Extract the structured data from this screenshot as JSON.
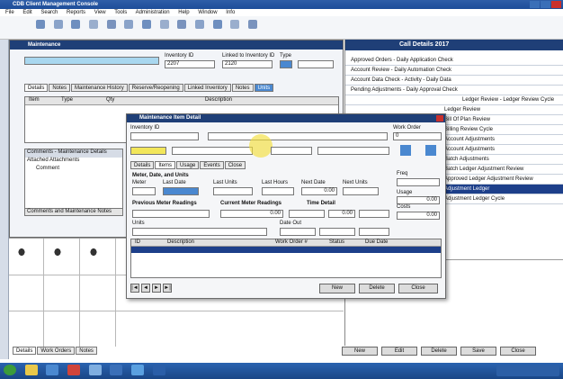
{
  "titlebar": {
    "title": "CDB Client Management Console"
  },
  "menubar": [
    "File",
    "Edit",
    "Search",
    "Reports",
    "View",
    "Tools",
    "Administration",
    "Help",
    "Window",
    "Info"
  ],
  "right_panel": {
    "header": "Call Details 2017",
    "items": [
      "Approved Orders - Daily Application Check",
      "Account Review - Daily Automation Check",
      "Account Data Check - Activity - Daily Data",
      "Pending Adjustments - Daily Approval Check",
      "Ledger Review - Ledger Review Cycle",
      "Ledger Review",
      "Bill Of Plan Review",
      "Billing Review Cycle",
      "Account Adjustments",
      "Account Adjustments",
      "Batch Adjustments",
      "Batch Ledger Adjustment Review",
      "Approved Ledger Adjustment Review",
      "Adjustment Ledger",
      "Adjustment Ledger Cycle"
    ],
    "selected_index": 13
  },
  "back_window": {
    "title": "Maintenance",
    "fields": {
      "inventory_id": "Inventory ID",
      "inventory_val": "2207",
      "linked_label": "Linked to Inventory ID",
      "linked_val": "2120",
      "type_label": "Type"
    },
    "tabs": [
      "Details",
      "Notes",
      "Maintenance History",
      "Reserve/Reopening",
      "Linked Inventory",
      "Notes",
      "Units"
    ],
    "table_headers": [
      "Item",
      "Type",
      "Qty",
      "Description"
    ],
    "section1": "Comments - Maintenance Details",
    "section2": "Attached Attachments",
    "row_label": "Comment",
    "bottom_label": "Comments and Maintenance Notes"
  },
  "dialog": {
    "title": "Maintenance Item Detail",
    "inventory_label": "Inventory ID",
    "status_label": "Work Order",
    "status_val": "0",
    "tabs": [
      "Details",
      "Items",
      "Usage",
      "Events",
      "Close"
    ],
    "sec_meter": "Meter, Date, and Units",
    "labels": [
      "Meter",
      "Last Date",
      "Last Units",
      "Last Hours",
      "Next Date",
      "Next Units",
      "Freq",
      "Usage"
    ],
    "sec_prev": "Previous Meter Readings",
    "sec_current": "Current Meter Readings",
    "sec_time": "Time Detail",
    "label_units": "Units",
    "label_date_out": "Date Out",
    "label_costs": "Costs",
    "values": [
      "0.00",
      "0.00",
      "0.00",
      "0.00",
      "0.00"
    ],
    "table_headers": [
      "ID",
      "Description",
      "Work Order #",
      "Status",
      "Due Date"
    ],
    "buttons": {
      "new": "New",
      "delete": "Delete",
      "close": "Close"
    }
  },
  "bottom_tabs": [
    "Details",
    "Work Orders",
    "Notes"
  ],
  "bottom_buttons": [
    "New",
    "Edit",
    "Delete",
    "Save",
    "Close"
  ],
  "taskbar": {
    "start": "Start"
  },
  "colors": {
    "titlebar": "#1d4d99",
    "selected": "#1d3f8a",
    "highlight": "#f2e65a",
    "accent_blue": "#4a88d0"
  }
}
